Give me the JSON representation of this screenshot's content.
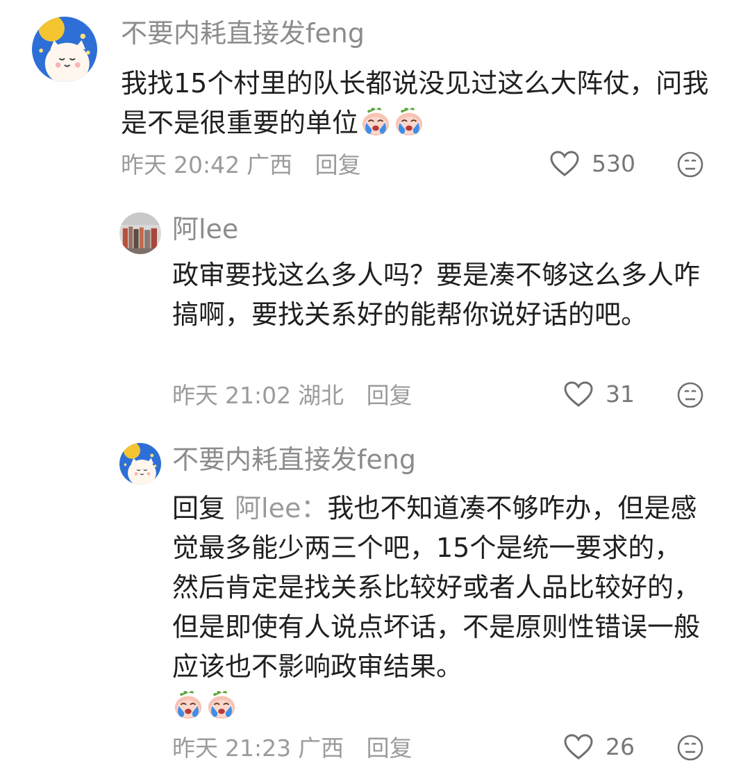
{
  "comments": [
    {
      "username": "不要内耗直接发feng",
      "text": "我找15个村里的队长都说没见过这么大阵仗，问我是不是很重要的单位",
      "emoji": [
        "crying-emoji",
        "crying-emoji"
      ],
      "date": "昨天",
      "time": "20:42",
      "location": "广西",
      "reply_label": "回复",
      "likes": "530",
      "like_icon": "heart-outline-icon",
      "dislike_icon": "meh-face-icon"
    },
    {
      "username": "阿lee",
      "text": "政审要找这么多人吗？要是凑不够这么多人咋搞啊，要找关系好的能帮你说好话的吧。",
      "date": "昨天",
      "time": "21:02",
      "location": "湖北",
      "reply_label": "回复",
      "likes": "31"
    },
    {
      "username": "不要内耗直接发feng",
      "reply_prefix": "回复",
      "reply_to": "阿lee：",
      "text": "我也不知道凑不够咋办，但是感觉最多能少两三个吧，15个是统一要求的，然后肯定是找关系比较好或者人品比较好的，但是即使有人说点坏话，不是原则性错误一般应该也不影响政审结果。",
      "emoji": [
        "crying-emoji",
        "crying-emoji"
      ],
      "date": "昨天",
      "time": "21:23",
      "location": "广西",
      "reply_label": "回复",
      "likes": "26"
    }
  ],
  "colors": {
    "username": "#8c8c8c",
    "text": "#1f1f1f",
    "meta": "#9b9b9b"
  }
}
